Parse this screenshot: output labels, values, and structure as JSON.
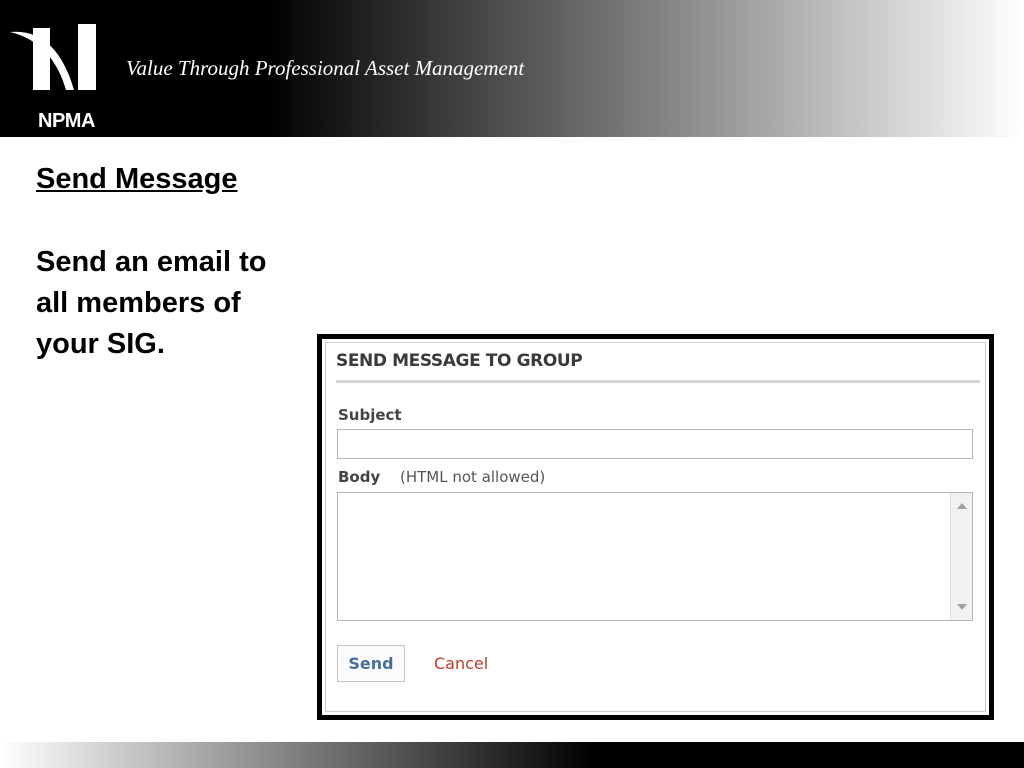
{
  "header": {
    "logo_text": "NPMA",
    "tagline": "Value Through Professional Asset Management"
  },
  "slide": {
    "title": "Send Message",
    "description": "Send an email to all members of your SIG."
  },
  "dialog": {
    "title": "SEND MESSAGE TO GROUP",
    "subject_label": "Subject",
    "subject_value": "",
    "body_label": "Body",
    "body_note": "(HTML not allowed)",
    "body_value": "",
    "send_label": "Send",
    "cancel_label": "Cancel"
  },
  "colors": {
    "send_text": "#4a6f9e",
    "cancel_text": "#c0392b"
  },
  "icons": {
    "logo": "npma-logo-icon",
    "scroll_up": "scroll-up-arrow-icon",
    "scroll_down": "scroll-down-arrow-icon"
  }
}
